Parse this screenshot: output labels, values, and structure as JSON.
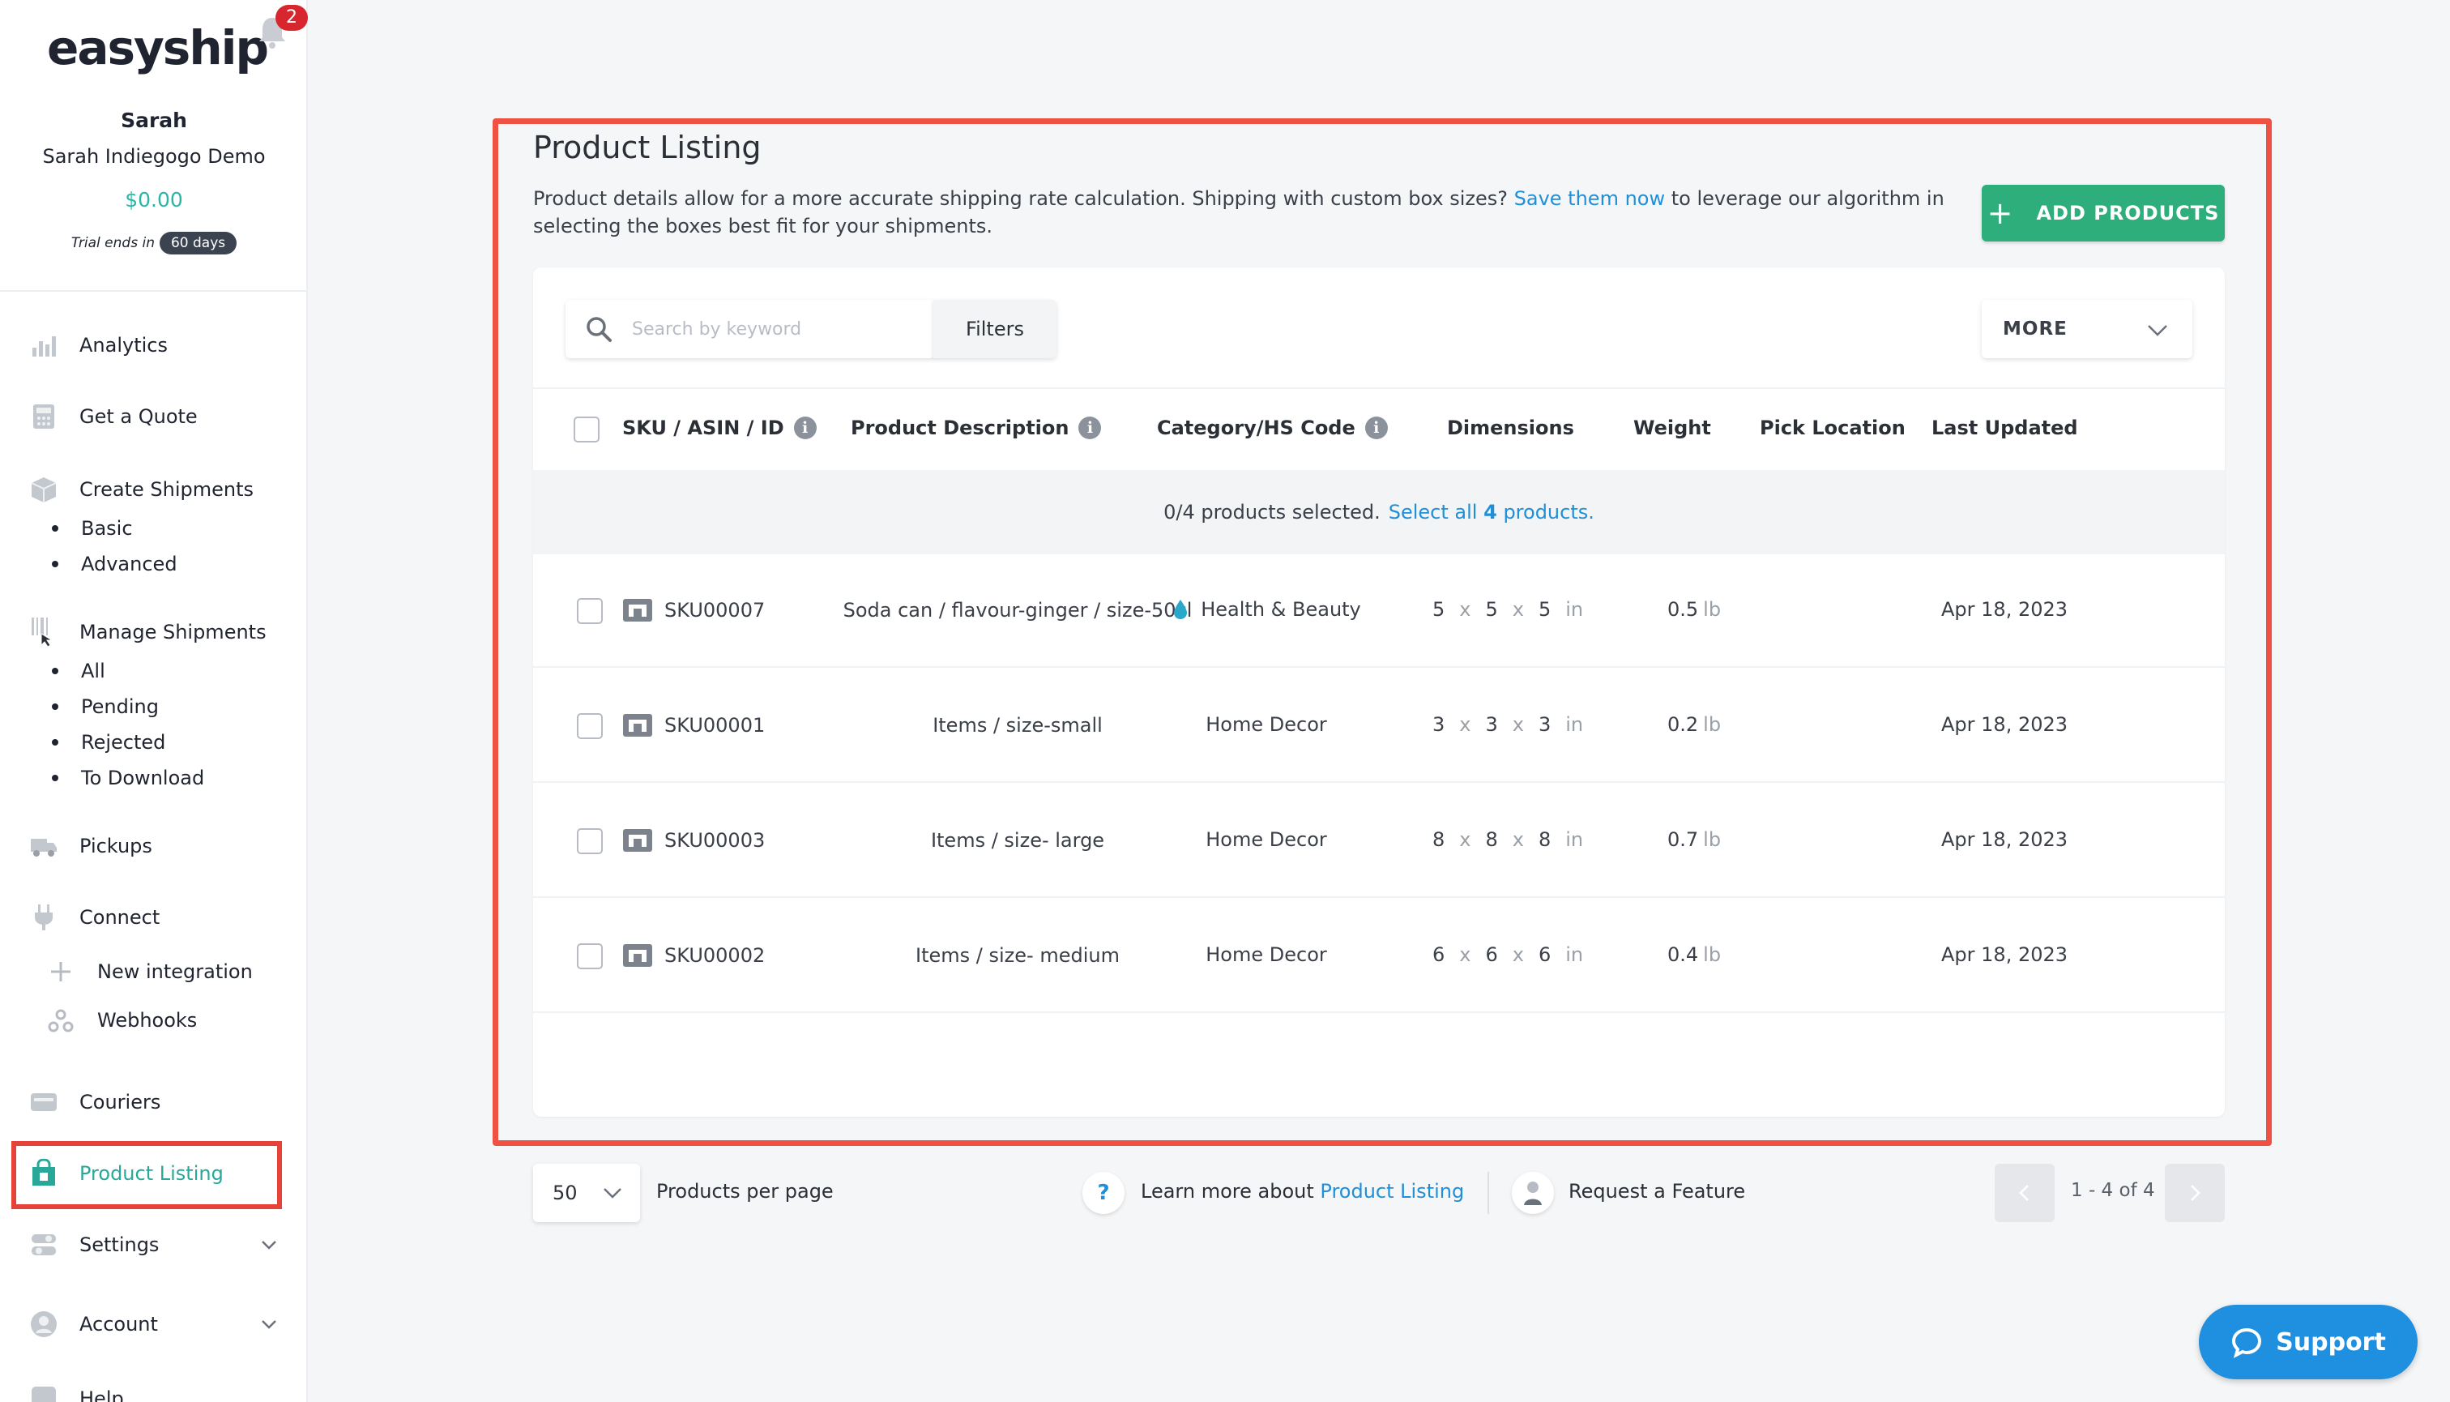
{
  "brand": {
    "logo_text": "easyship",
    "notification_count": "2"
  },
  "user": {
    "name": "Sarah",
    "company": "Sarah Indiegogo Demo",
    "balance": "$0.00",
    "trial_text": "Trial ends in",
    "trial_days": "60 days"
  },
  "sidebar": {
    "analytics": "Analytics",
    "get_quote": "Get a Quote",
    "create_shipments": "Create Shipments",
    "create_sub": [
      "Basic",
      "Advanced"
    ],
    "manage_shipments": "Manage Shipments",
    "manage_sub": [
      "All",
      "Pending",
      "Rejected",
      "To Download"
    ],
    "pickups": "Pickups",
    "connect": "Connect",
    "connect_sub": [
      "New integration",
      "Webhooks"
    ],
    "couriers": "Couriers",
    "product_listing": "Product Listing",
    "settings": "Settings",
    "account": "Account",
    "help": "Help"
  },
  "main": {
    "title": "Product Listing",
    "desc_before": "Product details allow for a more accurate shipping rate calculation. Shipping with custom box sizes?",
    "desc_link": "Save them now",
    "desc_after": "to leverage our algorithm in selecting the boxes best fit for your shipments.",
    "add_button": "ADD PRODUCTS",
    "search_placeholder": "Search by keyword",
    "filters": "Filters",
    "more": "MORE",
    "columns": {
      "sku": "SKU / ASIN / ID",
      "description": "Product Description",
      "category": "Category/HS Code",
      "dimensions": "Dimensions",
      "weight": "Weight",
      "pick_location": "Pick Location",
      "last_updated": "Last Updated"
    },
    "selection_text": "0/4 products selected.",
    "select_all_before": "Select all",
    "select_all_count": "4",
    "select_all_after": "products."
  },
  "products": [
    {
      "sku": "SKU00007",
      "desc": "Soda can / flavour-ginger / size-50cl",
      "category": "Health & Beauty",
      "l": "5",
      "w": "5",
      "h": "5",
      "dim_unit": "in",
      "weight": "0.5",
      "weight_unit": "lb",
      "updated": "Apr 18, 2023"
    },
    {
      "sku": "SKU00001",
      "desc": "Items / size-small",
      "category": "Home Decor",
      "l": "3",
      "w": "3",
      "h": "3",
      "dim_unit": "in",
      "weight": "0.2",
      "weight_unit": "lb",
      "updated": "Apr 18, 2023"
    },
    {
      "sku": "SKU00003",
      "desc": "Items / size- large",
      "category": "Home Decor",
      "l": "8",
      "w": "8",
      "h": "8",
      "dim_unit": "in",
      "weight": "0.7",
      "weight_unit": "lb",
      "updated": "Apr 18, 2023"
    },
    {
      "sku": "SKU00002",
      "desc": "Items / size- medium",
      "category": "Home Decor",
      "l": "6",
      "w": "6",
      "h": "6",
      "dim_unit": "in",
      "weight": "0.4",
      "weight_unit": "lb",
      "updated": "Apr 18, 2023"
    }
  ],
  "dim_separator": "x",
  "footer": {
    "per_page_value": "50",
    "per_page_label": "Products per page",
    "help_q": "?",
    "learn_more": "Learn more about",
    "learn_link": "Product Listing",
    "request_feature": "Request a Feature",
    "page_info": "1 - 4 of 4"
  },
  "support": "Support",
  "colors": {
    "accent": "#29a899",
    "link": "#1f8fd8",
    "add_button": "#2dae7a",
    "highlight": "#ef5143",
    "support": "#1f8fe0"
  }
}
